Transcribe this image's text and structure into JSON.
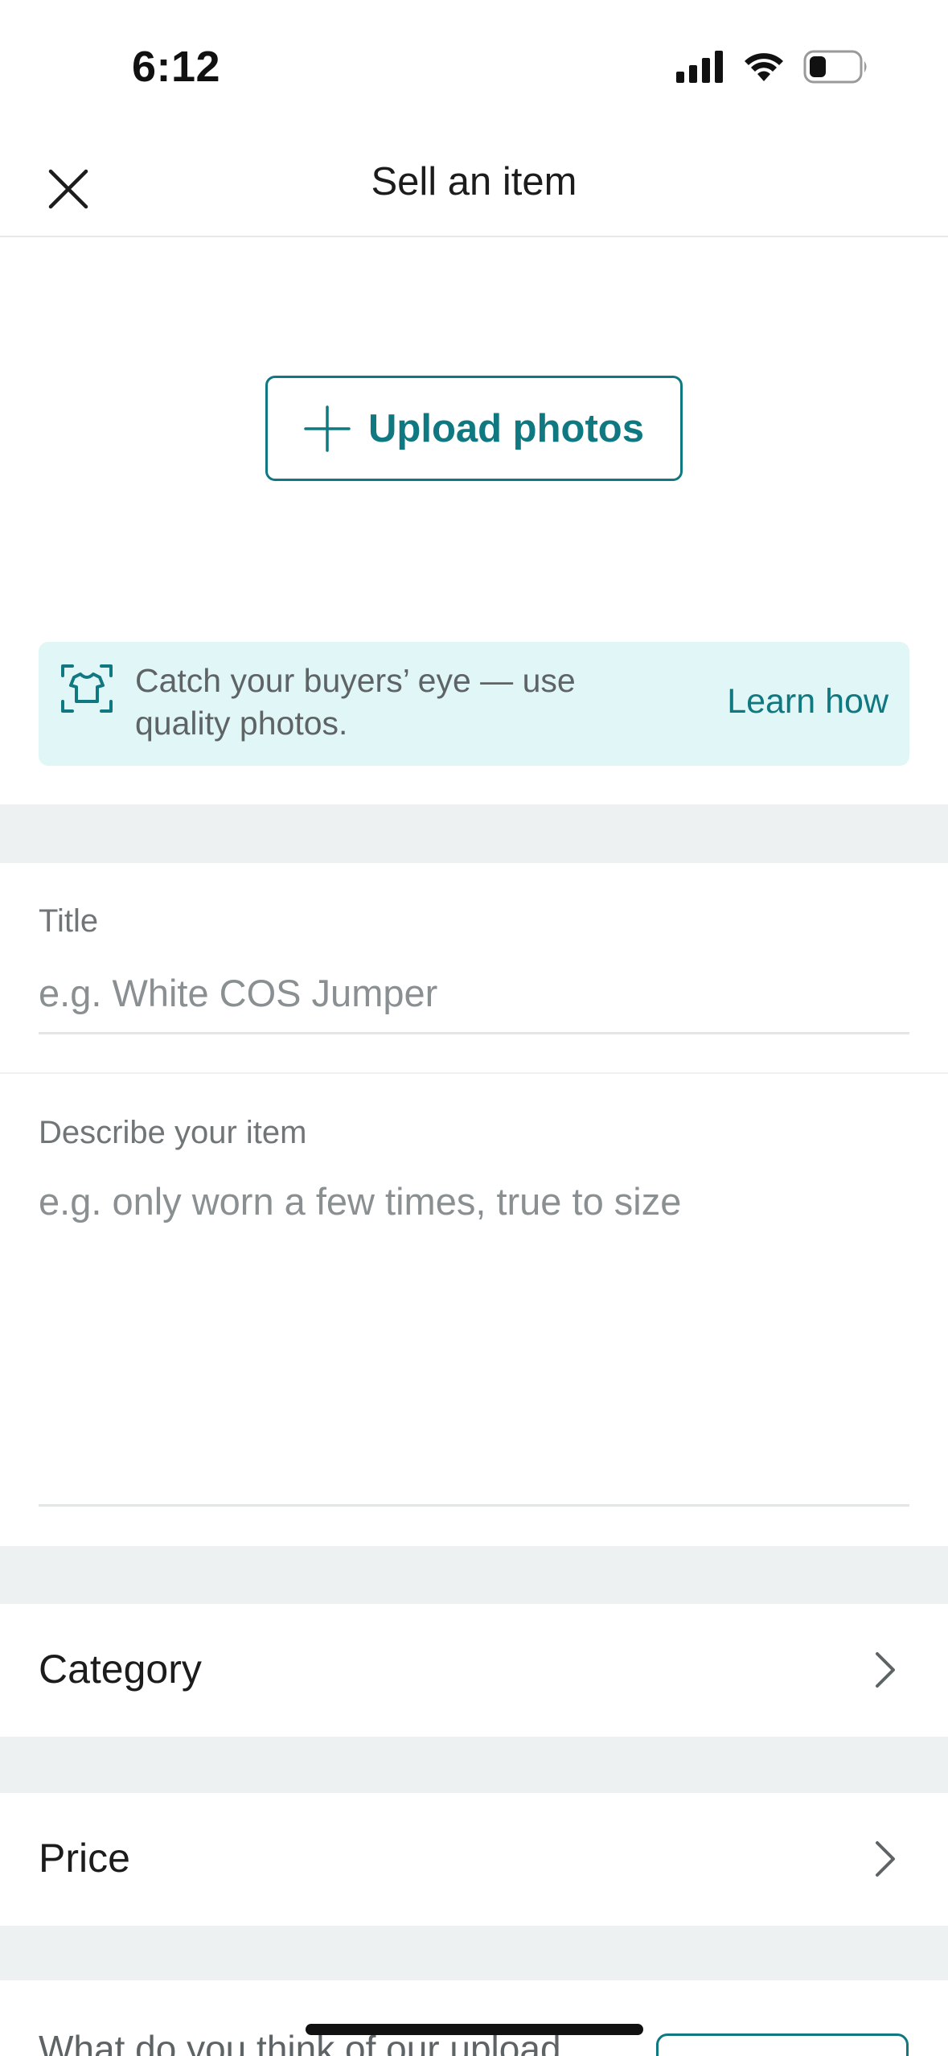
{
  "status_bar": {
    "time": "6:12",
    "icons": [
      "cellular-signal-icon",
      "wifi-icon",
      "battery-icon"
    ]
  },
  "nav": {
    "title": "Sell an item",
    "close_icon": "close-icon"
  },
  "upload": {
    "button_label": "Upload photos",
    "icon": "plus-icon"
  },
  "tip": {
    "icon": "shirt-scan-icon",
    "text": "Catch your buyers’ eye — use quality photos.",
    "link_label": "Learn how"
  },
  "form": {
    "title": {
      "label": "Title",
      "placeholder": "e.g. White COS Jumper",
      "value": ""
    },
    "description": {
      "label": "Describe your item",
      "placeholder": "e.g. only worn a few times, true to size",
      "value": ""
    }
  },
  "rows": {
    "category": {
      "label": "Category",
      "icon": "chevron-right-icon"
    },
    "price": {
      "label": "Price",
      "icon": "chevron-right-icon"
    }
  },
  "feedback": {
    "text": "What do you think of our upload"
  },
  "colors": {
    "accent": "#0f7880",
    "tip_background": "#e1f6f6",
    "section_gap": "#eef1f2",
    "muted_text": "#707578"
  }
}
